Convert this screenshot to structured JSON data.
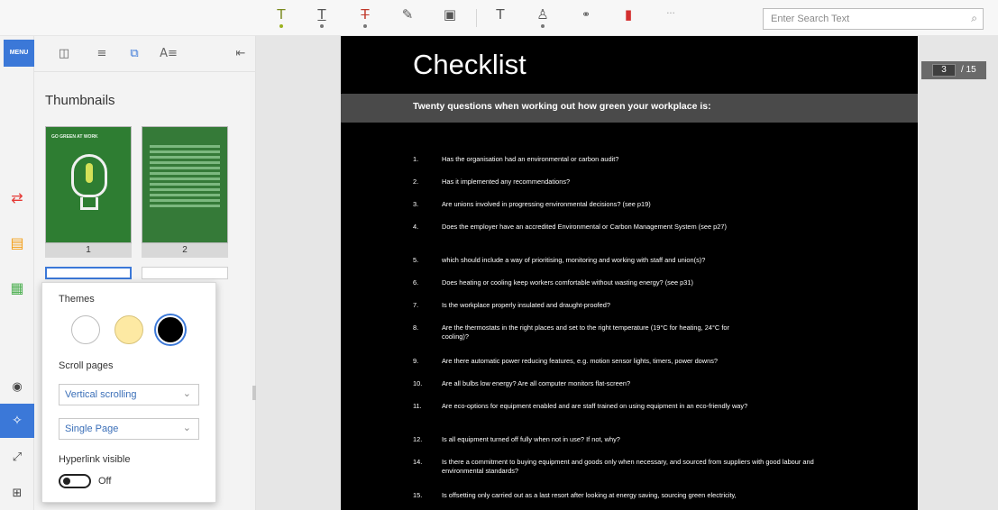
{
  "toolbar": {
    "tools": [
      {
        "name": "highlight-text-icon",
        "glyph": "T"
      },
      {
        "name": "underline-text-icon",
        "glyph": "T"
      },
      {
        "name": "strikethrough-text-icon",
        "glyph": "T"
      },
      {
        "name": "pen-icon",
        "glyph": "✎"
      },
      {
        "name": "image-icon",
        "glyph": "▣"
      },
      {
        "name": "text-tool-icon",
        "glyph": "T"
      },
      {
        "name": "stamp-icon",
        "glyph": "♙"
      },
      {
        "name": "link-icon",
        "glyph": "⚭"
      },
      {
        "name": "bookmark-icon",
        "glyph": "▮"
      },
      {
        "name": "more-icon",
        "glyph": "···"
      }
    ],
    "search_placeholder": "Enter Search Text"
  },
  "rail": {
    "top_label": "MENU"
  },
  "panel": {
    "title": "Thumbnails",
    "thumbnails": [
      {
        "label": "1",
        "cover_text": "GO GREEN AT WORK"
      },
      {
        "label": "2"
      }
    ]
  },
  "popup": {
    "themes_label": "Themes",
    "scroll_label": "Scroll pages",
    "scroll_value": "Vertical scrolling",
    "layout_value": "Single Page",
    "hyperlink_label": "Hyperlink visible",
    "toggle_state": "Off"
  },
  "document": {
    "title": "Checklist",
    "subtitle": "Twenty questions when working out how green your workplace is:",
    "questions": [
      {
        "num": "1.",
        "text": "Has the organisation had an environmental or carbon audit?"
      },
      {
        "num": "2.",
        "text": "Has it implemented any recommendations?"
      },
      {
        "num": "3.",
        "text": "Are unions involved in progressing environmental decisions? (see p19)"
      },
      {
        "num": "4.",
        "text": "Does the employer have an accredited Environmental or Carbon Management System (see p27)"
      },
      {
        "num": "5.",
        "text": "which should include a way of prioritising, monitoring and working with staff and union(s)?"
      },
      {
        "num": "6.",
        "text": "Does heating or cooling keep workers comfortable without wasting energy? (see p31)"
      },
      {
        "num": "7.",
        "text": "Is the workplace properly insulated and draught-proofed?"
      },
      {
        "num": "8.",
        "text": "Are the thermostats in the right places and set to the right temperature (19°C for heating, 24°C for cooling)?"
      },
      {
        "num": "9.",
        "text": "Are there automatic power reducing features, e.g. motion sensor lights, timers, power downs?"
      },
      {
        "num": "10.",
        "text": "Are all bulbs low energy? Are all computer monitors flat-screen?"
      },
      {
        "num": "11.",
        "text": "Are eco-options for equipment enabled and are staff trained on using equipment in an eco-friendly way?"
      },
      {
        "num": "12.",
        "text": "Is all equipment turned off fully when not in use? If not, why?"
      },
      {
        "num": "14.",
        "text": "Is there a commitment to buying equipment and goods only when necessary, and sourced from suppliers with good labour and environmental standards?"
      },
      {
        "num": "15.",
        "text": "Is offsetting only carried out as a last resort after looking at energy saving, sourcing green electricity,"
      }
    ]
  },
  "pager": {
    "current": "3",
    "total": "/ 15"
  }
}
